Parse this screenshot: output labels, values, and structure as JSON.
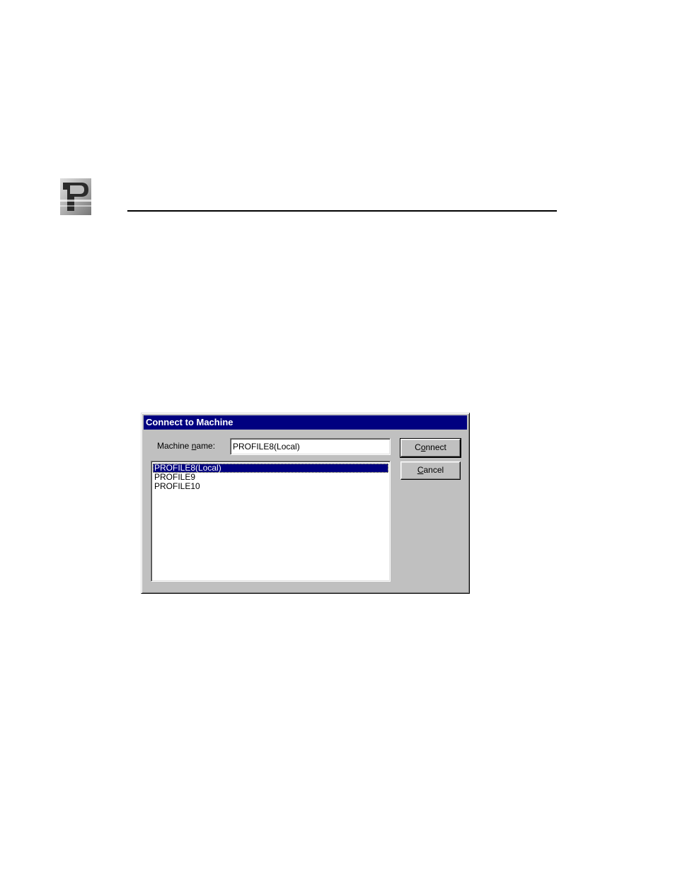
{
  "dialog": {
    "title": "Connect to Machine",
    "machine_name_label_prefix": "Machine ",
    "machine_name_label_access": "n",
    "machine_name_label_suffix": "ame:",
    "machine_name_value": "PROFILE8(Local)",
    "machines": [
      "PROFILE8(Local)",
      "PROFILE9",
      "PROFILE10"
    ],
    "selected_index": 0,
    "connect_prefix": "C",
    "connect_access": "o",
    "connect_suffix": "nnect",
    "cancel_access": "C",
    "cancel_suffix": "ancel"
  },
  "colors": {
    "titlebar": "#000080",
    "dialog_face": "#c0c0c0",
    "selection": "#000080"
  },
  "icons": {
    "logo": "company-logo-icon"
  }
}
